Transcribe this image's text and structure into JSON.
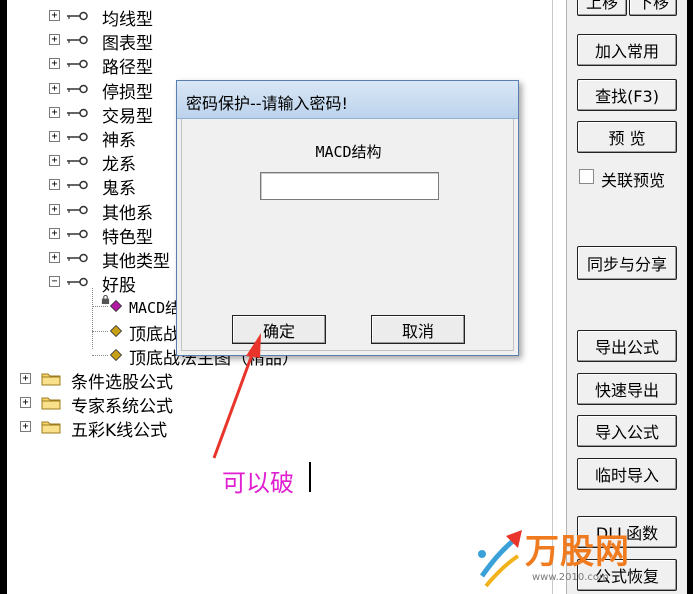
{
  "tree": {
    "items": [
      {
        "label": "均线型",
        "type": "key",
        "expander": "+"
      },
      {
        "label": "图表型",
        "type": "key",
        "expander": "+"
      },
      {
        "label": "路径型",
        "type": "key",
        "expander": "+"
      },
      {
        "label": "停损型",
        "type": "key",
        "expander": "+"
      },
      {
        "label": "交易型",
        "type": "key",
        "expander": "+"
      },
      {
        "label": "神系",
        "type": "key",
        "expander": "+"
      },
      {
        "label": "龙系",
        "type": "key",
        "expander": "+"
      },
      {
        "label": "鬼系",
        "type": "key",
        "expander": "+"
      },
      {
        "label": "其他系",
        "type": "key",
        "expander": "+"
      },
      {
        "label": "特色型",
        "type": "key",
        "expander": "+"
      },
      {
        "label": "其他类型",
        "type": "key",
        "expander": "+"
      },
      {
        "label": "好股",
        "type": "key",
        "expander": "−"
      },
      {
        "label": "MACD结",
        "type": "formula-locked"
      },
      {
        "label": "顶底战",
        "type": "formula"
      },
      {
        "label": "顶底战法主图（精品）",
        "type": "formula"
      },
      {
        "label": "条件选股公式",
        "type": "folder",
        "expander": "+"
      },
      {
        "label": "专家系统公式",
        "type": "folder",
        "expander": "+"
      },
      {
        "label": "五彩K线公式",
        "type": "folder",
        "expander": "+"
      }
    ]
  },
  "right_panel": {
    "buttons": {
      "move_up": "上移",
      "move_down": "下移",
      "add_common": "加入常用",
      "find": "查找(F3)",
      "preview": "预  览",
      "sync_share": "同步与分享",
      "export_formula": "导出公式",
      "quick_export": "快速导出",
      "import_formula": "导入公式",
      "temp_import": "临时导入",
      "dll_func": "DLL函数",
      "formula_restore": "公式恢复"
    },
    "link_preview_label": "关联预览",
    "link_preview_checked": false
  },
  "dialog": {
    "title": "密码保护--请输入密码!",
    "prompt": "MACD结构",
    "password_value": "",
    "ok_label": "确定",
    "cancel_label": "取消"
  },
  "annotation": {
    "text": "可以破",
    "color": "#e020d0",
    "arrow_color": "#e8342a"
  },
  "watermark": {
    "brand": "万股网",
    "url": "www.2010.com",
    "brand_color": "#f07a1e"
  }
}
